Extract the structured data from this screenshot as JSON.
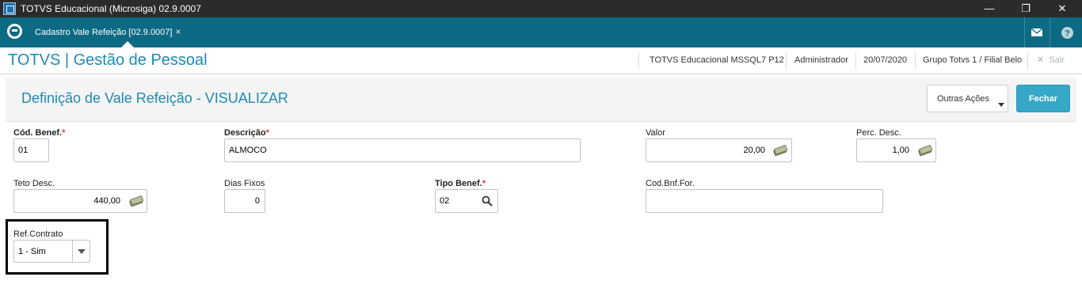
{
  "window": {
    "title": "TOTVS Educacional (Microsiga) 02.9.0007",
    "minimize": "—",
    "maximize": "❐",
    "close": "✕"
  },
  "appbar": {
    "tab_label": "Cadastro Vale Refeição [02.9.0007]",
    "tab_close": "×"
  },
  "header": {
    "brand": "TOTVS | Gestão de Pessoal",
    "environment": "TOTVS Educacional MSSQL7 P12",
    "user": "Administrador",
    "date": "20/07/2020",
    "branch": "Grupo Totvs 1 / Filial Belo",
    "exit_label": "Sair",
    "exit_icon": "✕"
  },
  "panel": {
    "title": "Definição de Vale Refeição - VISUALIZAR",
    "other_actions": "Outras Ações",
    "close_button": "Fechar"
  },
  "fields": {
    "cod_benef": {
      "label": "Cód. Benef.",
      "value": "01"
    },
    "descricao": {
      "label": "Descrição",
      "value": "ALMOCO"
    },
    "valor": {
      "label": "Valor",
      "value": "20,00"
    },
    "perc_desc": {
      "label": "Perc. Desc.",
      "value": "1,00"
    },
    "teto_desc": {
      "label": "Teto Desc.",
      "value": "440,00"
    },
    "dias_fixos": {
      "label": "Dias Fixos",
      "value": "0"
    },
    "tipo_benef": {
      "label": "Tipo Benef.",
      "value": "02"
    },
    "cod_bnf_for": {
      "label": "Cod.Bnf.For.",
      "value": ""
    },
    "ref_contrato": {
      "label": "Ref.Contrato",
      "value": "1 - Sim"
    }
  },
  "required_marker": "*",
  "colors": {
    "titlebar": "#2b2b2b",
    "appbar": "#0c6a85",
    "brand_text": "#1e8bb5",
    "primary_button": "#36a7c7",
    "required": "#e23a3a"
  }
}
